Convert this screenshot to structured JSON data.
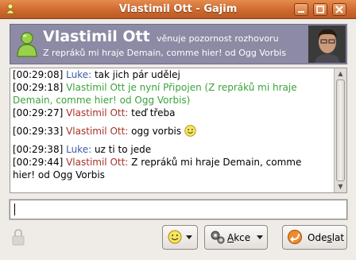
{
  "window": {
    "title": "Vlastimil Ott - Gajim",
    "controls": [
      "minimize",
      "maximize",
      "close"
    ]
  },
  "banner": {
    "contact_name": "Vlastimil Ott",
    "chat_state": "věnuje pozornost rozhovoru",
    "status_message": "Z repráků mi hraje Demain, comme hier! od Ogg Vorbis",
    "status_icon": "online-person-icon",
    "banner_color": "#8c8aa4"
  },
  "conversation": {
    "lines": [
      {
        "time": "[00:29:08]",
        "nick": "Luke:",
        "text": " tak jich pár udělej",
        "kind": "luke"
      },
      {
        "time": "[00:29:18]",
        "text": " Vlastimil Ott je nyní Připojen (Z repráků mi hraje",
        "kind": "status"
      },
      {
        "text": "Demain, comme hier! od Ogg Vorbis)",
        "kind": "status-cont"
      },
      {
        "time": "[00:29:27]",
        "nick": "Vlastimil Ott:",
        "text": " teď třeba",
        "kind": "ott"
      },
      {
        "time": "[00:29:33]",
        "nick": "Vlastimil Ott:",
        "text": " ogg vorbis ",
        "kind": "ott",
        "emoticon": "smile-emoticon"
      },
      {
        "time": "[00:29:38]",
        "nick": "Luke:",
        "text": " uz ti to jede",
        "kind": "luke"
      },
      {
        "time": "[00:29:44]",
        "nick": "Vlastimil Ott:",
        "text": " Z repráků mi hraje Demain, comme",
        "kind": "ott"
      },
      {
        "text": "hier! od Ogg Vorbis",
        "kind": "cont"
      }
    ],
    "colors": {
      "luke": "#3b5caa",
      "ott": "#a63229",
      "status": "#3aa33a"
    }
  },
  "input": {
    "value": ""
  },
  "buttons": {
    "emoticons_icon": "smile-emoticon",
    "actions_label_underlined": "A",
    "actions_label_rest": "kce",
    "send_label_start": "Ode",
    "send_label_underlined": "s",
    "send_label_end": "lat"
  }
}
